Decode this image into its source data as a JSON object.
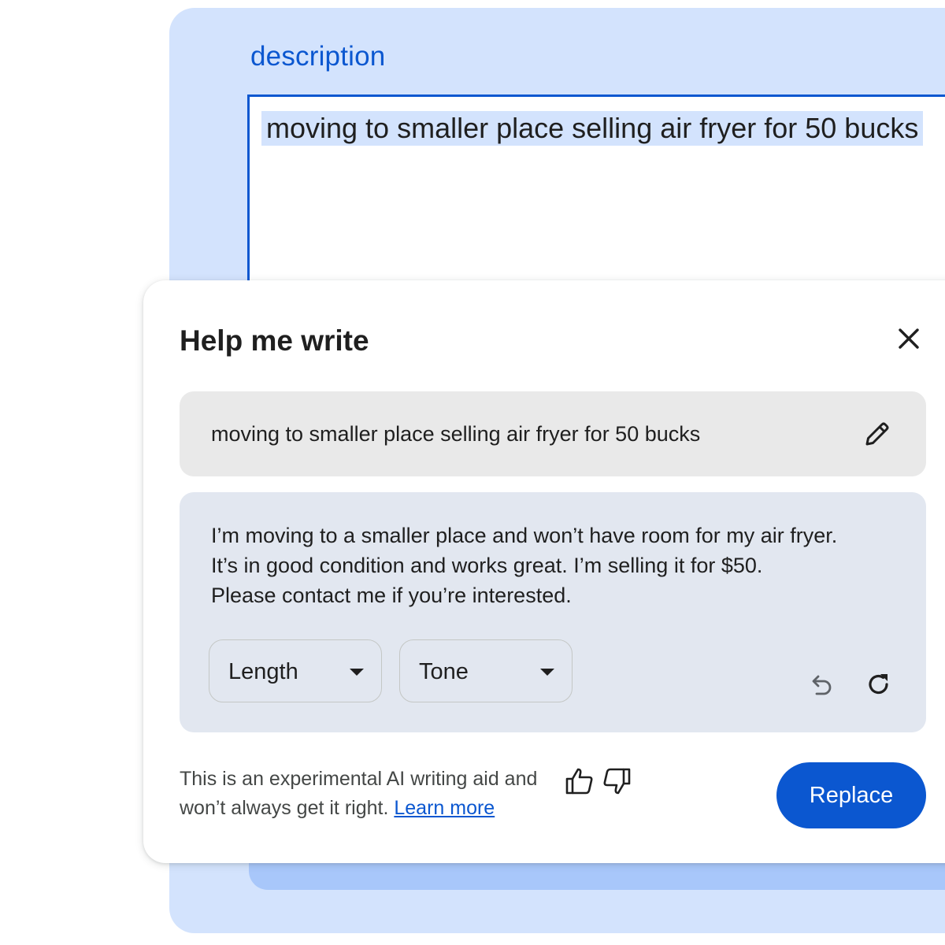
{
  "page": {
    "field_label": "description",
    "field_value": "moving to smaller place selling air fryer for 50 bucks"
  },
  "dialog": {
    "title": "Help me write",
    "close_icon": "close-icon",
    "prompt": {
      "text": "moving to smaller place selling air fryer for 50 bucks",
      "edit_icon": "pencil-icon"
    },
    "result": {
      "lines": [
        "I’m moving to a smaller place and won’t have room for my air fryer.",
        "It’s in good condition and works great. I’m selling it for $50.",
        "Please contact me if you’re interested."
      ],
      "length_label": "Length",
      "tone_label": "Tone",
      "undo_icon": "undo-icon",
      "refresh_icon": "refresh-icon"
    },
    "footer": {
      "disclaimer_line1": "This is an experimental AI writing aid and",
      "disclaimer_line2": "won’t always get it right.",
      "learn_more": "Learn more",
      "thumbs_up_icon": "thumbs-up-icon",
      "thumbs_down_icon": "thumbs-down-icon",
      "replace_label": "Replace"
    }
  },
  "colors": {
    "accent": "#0b57d0",
    "background_card": "#d3e3fd",
    "prompt_box": "#e9e9e9",
    "result_box": "#e2e7f0"
  }
}
